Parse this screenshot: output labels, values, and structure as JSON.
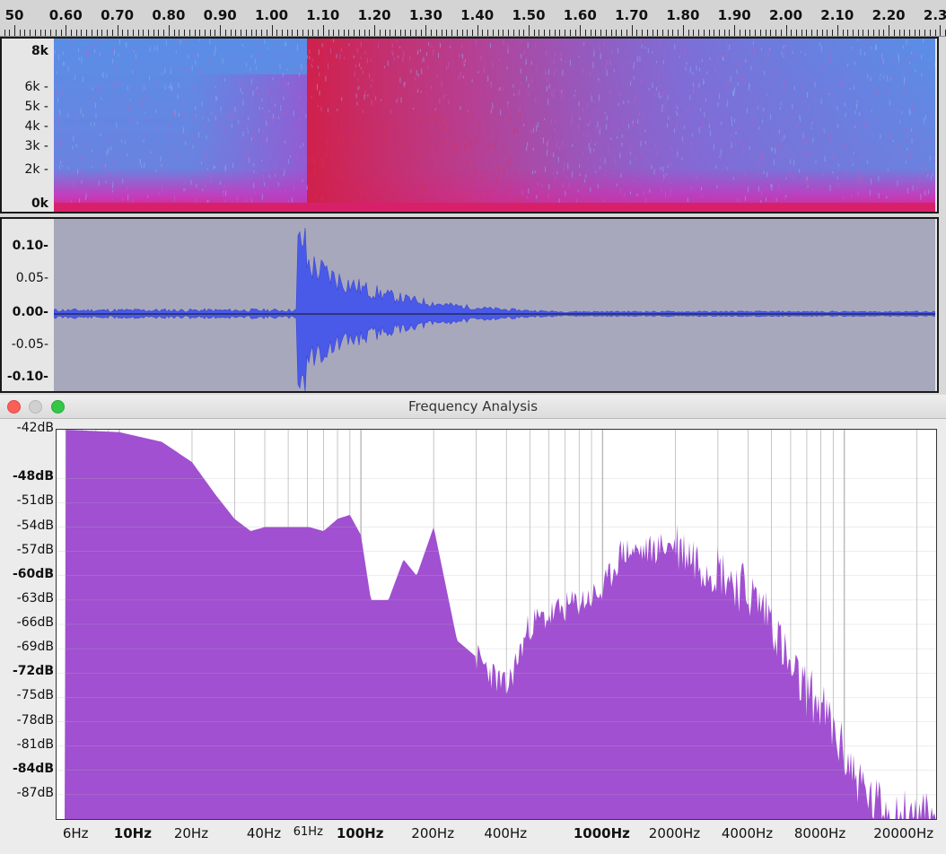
{
  "timeline": {
    "labels": [
      "50",
      "0.60",
      "0.70",
      "0.80",
      "0.90",
      "1.00",
      "1.10",
      "1.20",
      "1.30",
      "1.40",
      "1.50",
      "1.60",
      "1.70",
      "1.80",
      "1.90",
      "2.00",
      "2.10",
      "2.20",
      "2.30"
    ]
  },
  "spectrogram": {
    "freq_labels": [
      "8k",
      "6k",
      "5k",
      "4k",
      "3k",
      "2k",
      "0k"
    ]
  },
  "waveform": {
    "amp_labels": [
      "0.10",
      "0.05",
      "0.00",
      "-0.05",
      "-0.10"
    ]
  },
  "frequency_analysis": {
    "title": "Frequency Analysis",
    "db_labels": [
      "-42dB",
      "-48dB",
      "-51dB",
      "-54dB",
      "-57dB",
      "-60dB",
      "-63dB",
      "-66dB",
      "-69dB",
      "-72dB",
      "-75dB",
      "-78dB",
      "-81dB",
      "-84dB",
      "-87dB"
    ],
    "hz_labels": [
      "6Hz",
      "10Hz",
      "20Hz",
      "40Hz",
      "61Hz",
      "100Hz",
      "200Hz",
      "400Hz",
      "1000Hz",
      "2000Hz",
      "4000Hz",
      "8000Hz",
      "20000Hz"
    ],
    "colors": {
      "fill": "#a050d0",
      "grid": "#b8b8b8"
    }
  },
  "chart_data": {
    "type": "area",
    "x": [
      6,
      10,
      15,
      20,
      25,
      30,
      35,
      40,
      50,
      61,
      70,
      80,
      90,
      100,
      110,
      130,
      150,
      170,
      200,
      250,
      300,
      400,
      500,
      700,
      1000,
      1200,
      1500,
      2000,
      2500,
      3000,
      4000,
      5000,
      6000,
      8000,
      10000,
      13000,
      20000
    ],
    "y": [
      -42,
      -42.3,
      -43.5,
      -46,
      -50,
      -53,
      -54.5,
      -54,
      -54,
      -54,
      -54.5,
      -53,
      -52.5,
      -55,
      -63,
      -63,
      -58,
      -60,
      -54,
      -68,
      -70,
      -74,
      -66,
      -64,
      -62,
      -57,
      -57,
      -56,
      -58,
      -59,
      -62,
      -65,
      -72,
      -76,
      -82,
      -88,
      -90
    ],
    "xlabel": "",
    "ylabel": "",
    "xscale": "log",
    "ylim": [
      -90,
      -42
    ]
  }
}
